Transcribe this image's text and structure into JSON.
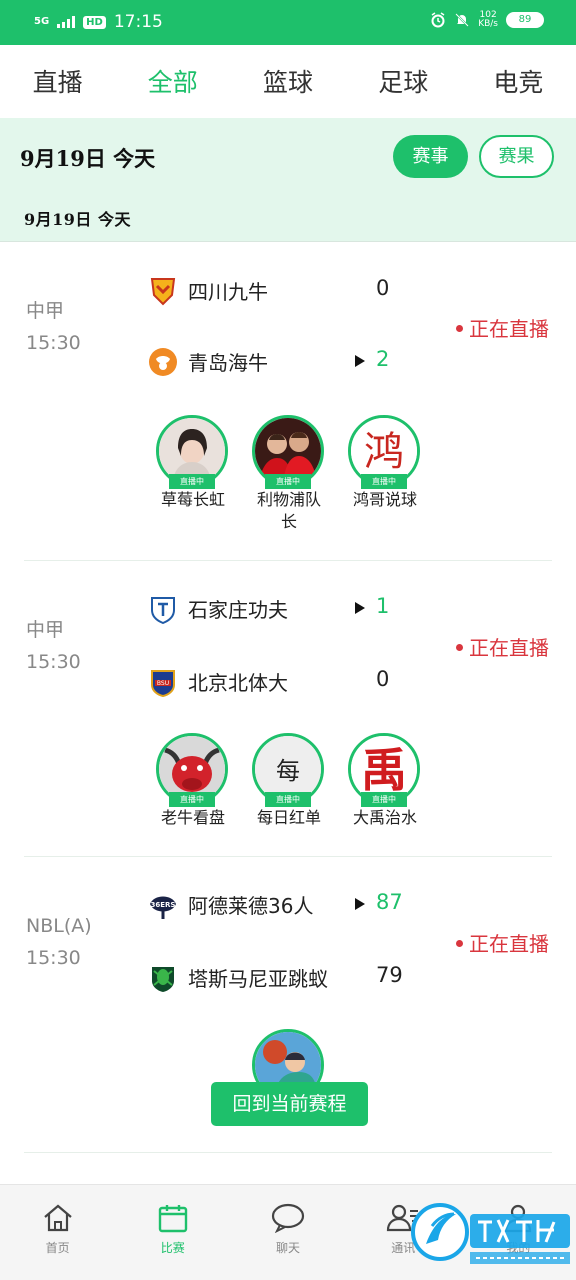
{
  "status_bar": {
    "network": "5G",
    "hd": "HD",
    "time": "17:15",
    "speed_value": "102",
    "speed_unit": "KB/s",
    "battery": "89"
  },
  "category_tabs": [
    {
      "label": "直播"
    },
    {
      "label": "全部",
      "active": true
    },
    {
      "label": "篮球"
    },
    {
      "label": "足球"
    },
    {
      "label": "电竞"
    }
  ],
  "date_header": {
    "title": "9月19日 今天",
    "events_button": "赛事",
    "results_button": "赛果",
    "subtitle": "9月19日   今天"
  },
  "matches": [
    {
      "league": "中甲",
      "time": "15:30",
      "home": {
        "name": "四川九牛",
        "score": "0",
        "logo": "sichuan-jiuniu-logo"
      },
      "away": {
        "name": "青岛海牛",
        "score": "2",
        "logo": "qingdao-hainiu-logo",
        "winner": true
      },
      "status": "正在直播",
      "streamers": [
        {
          "name": "草莓长虹",
          "tag": "直播中"
        },
        {
          "name": "利物浦队长",
          "tag": "直播中"
        },
        {
          "name": "鸿哥说球",
          "tag": "直播中",
          "glyph": "鸿"
        }
      ]
    },
    {
      "league": "中甲",
      "time": "15:30",
      "home": {
        "name": "石家庄功夫",
        "score": "1",
        "logo": "shijiazhuang-gongfu-logo",
        "winner": true
      },
      "away": {
        "name": "北京北体大",
        "score": "0",
        "logo": "beijing-bsu-logo"
      },
      "status": "正在直播",
      "streamers": [
        {
          "name": "老牛看盘",
          "tag": "直播中"
        },
        {
          "name": "每日红单",
          "tag": "直播中",
          "glyph": "每"
        },
        {
          "name": "大禹治水",
          "tag": "直播中",
          "glyph": "禹"
        }
      ]
    },
    {
      "league": "NBL(A)",
      "time": "15:30",
      "home": {
        "name": "阿德莱德36人",
        "score": "87",
        "logo": "adelaide-36ers-logo",
        "winner": true
      },
      "away": {
        "name": "塔斯马尼亚跳蚁",
        "score": "79",
        "logo": "tasmania-jackjumpers-logo"
      },
      "status": "正在直播"
    }
  ],
  "back_button": "回到当前赛程",
  "bottom_nav": [
    {
      "label": "首页",
      "icon": "home-icon"
    },
    {
      "label": "比赛",
      "icon": "calendar-icon",
      "active": true
    },
    {
      "label": "聊天",
      "icon": "chat-icon"
    },
    {
      "label": "通讯",
      "icon": "contacts-icon"
    },
    {
      "label": "我的",
      "icon": "profile-icon"
    }
  ],
  "watermark": {
    "brand": "飞翔下载",
    "site": "www.FFXZ.com"
  },
  "colors": {
    "accent": "#1ec06b",
    "live": "#d9363e",
    "header_bg": "#e3f7ec"
  }
}
